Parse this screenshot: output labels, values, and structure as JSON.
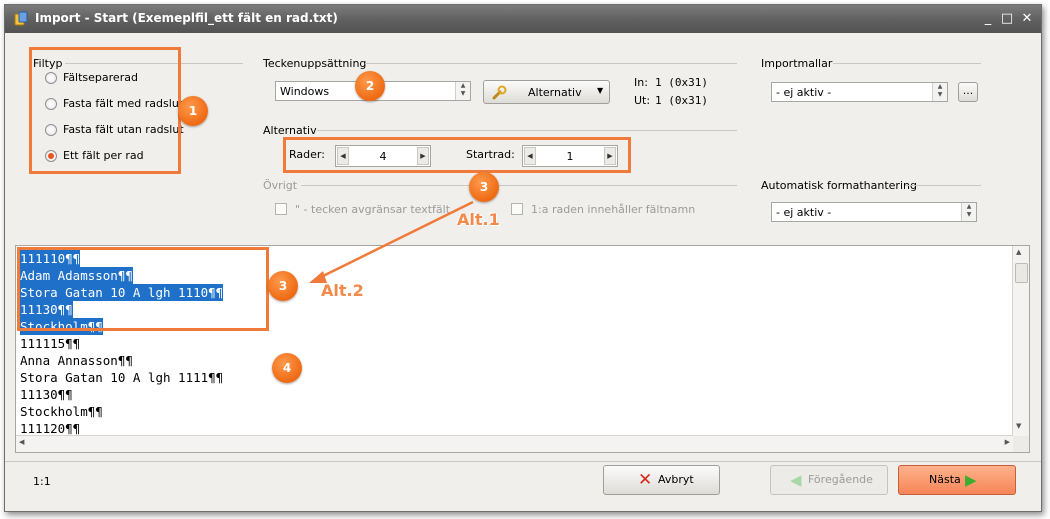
{
  "window": {
    "title": "Import - Start  (Exemeplfil_ett fält en rad.txt)",
    "controls": [
      "_",
      "□",
      "✕"
    ]
  },
  "filtyp": {
    "label": "Filtyp",
    "options": [
      {
        "label": "Fältseparerad",
        "checked": false
      },
      {
        "label": "Fasta fält med radslut",
        "checked": false
      },
      {
        "label": "Fasta fält utan radslut",
        "checked": false
      },
      {
        "label": "Ett fält per rad",
        "checked": true
      }
    ]
  },
  "charset": {
    "label": "Teckenuppsättning",
    "value": "Windows",
    "alternativ_button": "Alternativ",
    "in_label": "In:",
    "in_value": "1 (0x31)",
    "out_label": "Ut:",
    "out_value": "1 (0x31)"
  },
  "alternativ": {
    "label": "Alternativ",
    "rows_label": "Rader:",
    "rows_value": "4",
    "startrow_label": "Startrad:",
    "startrow_value": "1"
  },
  "ovrigt": {
    "label": "Övrigt",
    "textfield_option": "\" - tecken avgränsar textfält",
    "firstrow_option": "1:a raden innehåller fältnamn"
  },
  "importmallar": {
    "label": "Importmallar",
    "value": "- ej aktiv -",
    "more_button": "..."
  },
  "auto_format": {
    "label": "Automatisk formathantering",
    "value": "- ej aktiv -"
  },
  "preview": {
    "lines": [
      {
        "text": "111110¶¶",
        "selected": true
      },
      {
        "text": "Adam Adamsson¶¶",
        "selected": true
      },
      {
        "text": "Stora Gatan 10 A lgh 1110¶¶",
        "selected": true
      },
      {
        "text": "11130¶¶",
        "selected": true
      },
      {
        "text": "Stockholm¶¶",
        "selected": true
      },
      {
        "text": "111115¶¶",
        "selected": false
      },
      {
        "text": "Anna Annasson¶¶",
        "selected": false
      },
      {
        "text": "Stora Gatan 10 A lgh 1111¶¶",
        "selected": false
      },
      {
        "text": "11130¶¶",
        "selected": false
      },
      {
        "text": "Stockholm¶¶",
        "selected": false
      },
      {
        "text": "111120¶¶",
        "selected": false
      }
    ]
  },
  "annotations": {
    "badge_1": "1",
    "badge_2": "2",
    "badge_3a": "3",
    "badge_3b": "3",
    "badge_4": "4",
    "alt1": "Alt.1",
    "alt2": "Alt.2",
    "accent": "#f07a3a"
  },
  "footer": {
    "position": "1:1",
    "cancel": "Avbryt",
    "previous": "Föregående",
    "next": "Nästa"
  }
}
